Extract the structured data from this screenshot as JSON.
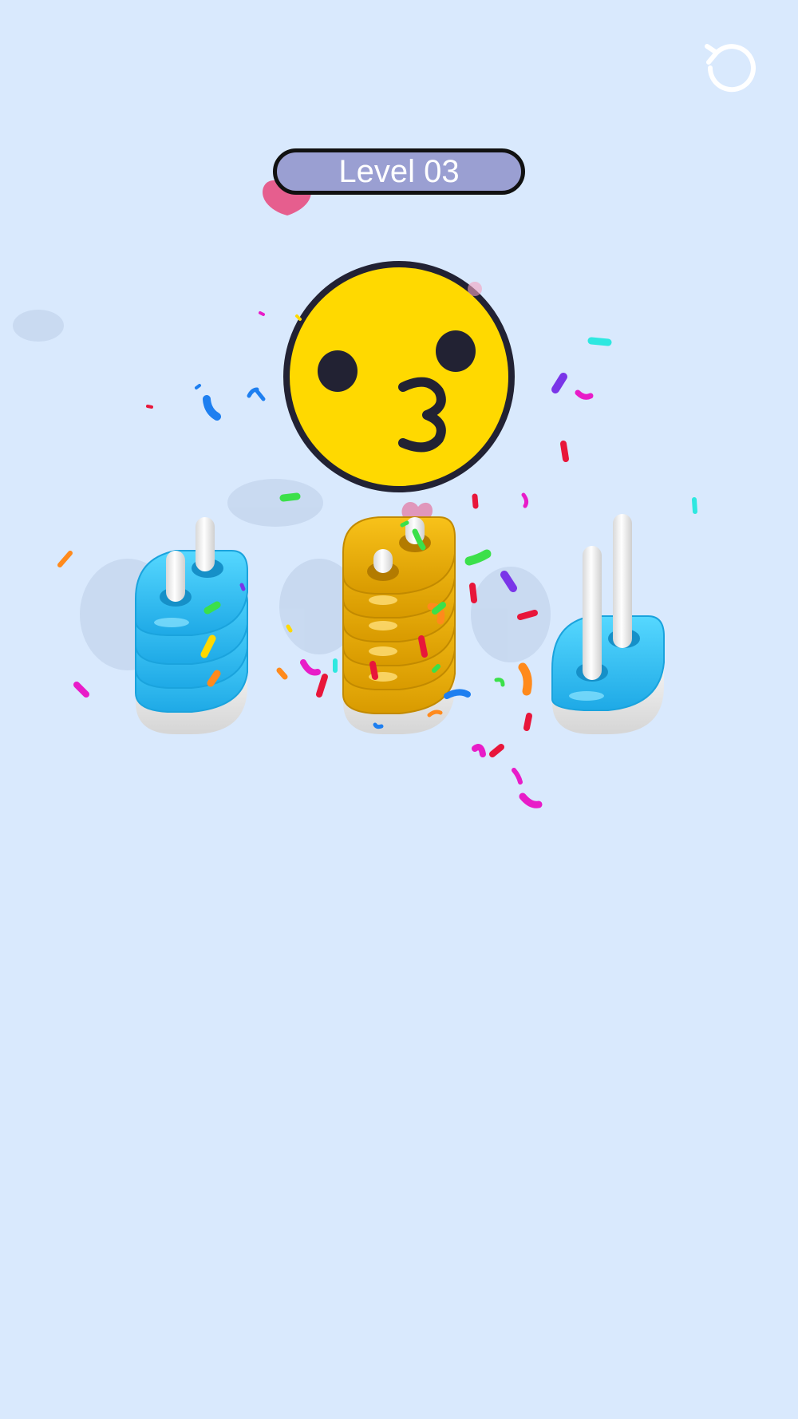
{
  "header": {
    "level_label": "Level 03",
    "restart_icon": "restart-icon"
  },
  "emoji": {
    "name": "kissing-face",
    "color": "#ffd900",
    "outline": "#222233"
  },
  "colors": {
    "background": "#d9e9fd",
    "blue_ring": "#2bc3f3",
    "gold_ring": "#e6a800",
    "peg": "#f2f2f2",
    "pill_fill": "#9a9fd2"
  },
  "stacks": [
    {
      "name": "left-stack",
      "ring_color": "blue",
      "ring_count": 4
    },
    {
      "name": "middle-stack",
      "ring_color": "gold",
      "ring_count": 6
    },
    {
      "name": "right-stack",
      "ring_color": "blue",
      "ring_count": 1
    }
  ]
}
